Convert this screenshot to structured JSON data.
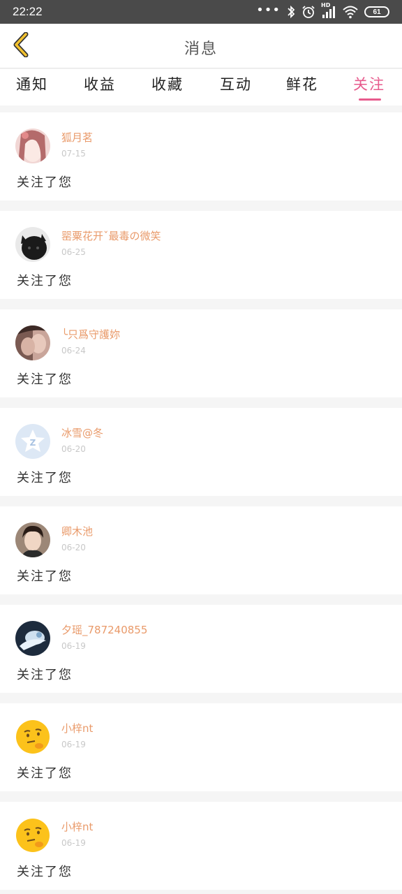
{
  "status_bar": {
    "time": "22:22",
    "dots": "•••",
    "network_label": "HD",
    "battery": "61"
  },
  "header": {
    "title": "消息",
    "back_icon": "chevron-left-icon",
    "accent_color": "#f2c12e"
  },
  "tabs": [
    {
      "label": "通知",
      "active": false
    },
    {
      "label": "收益",
      "active": false
    },
    {
      "label": "收藏",
      "active": false
    },
    {
      "label": "互动",
      "active": false
    },
    {
      "label": "鲜花",
      "active": false
    },
    {
      "label": "关注",
      "active": true
    }
  ],
  "colors": {
    "active_tab": "#e75a8c",
    "username": "#e99a6a",
    "date": "#c8c8c8"
  },
  "items": [
    {
      "name": "狐月茗",
      "date": "07-15",
      "message": "关注了您"
    },
    {
      "name": "罂粟花开ˇ最毒の微笑",
      "date": "06-25",
      "message": "关注了您"
    },
    {
      "name": "╰只爲守護妳",
      "date": "06-24",
      "message": "关注了您"
    },
    {
      "name": "冰雪@冬",
      "date": "06-20",
      "message": "关注了您"
    },
    {
      "name": "卿木池",
      "date": "06-20",
      "message": "关注了您"
    },
    {
      "name": "夕瑶_787240855",
      "date": "06-19",
      "message": "关注了您"
    },
    {
      "name": "小梓nt",
      "date": "06-19",
      "message": "关注了您"
    },
    {
      "name": "小梓nt",
      "date": "06-19",
      "message": "关注了您"
    }
  ]
}
